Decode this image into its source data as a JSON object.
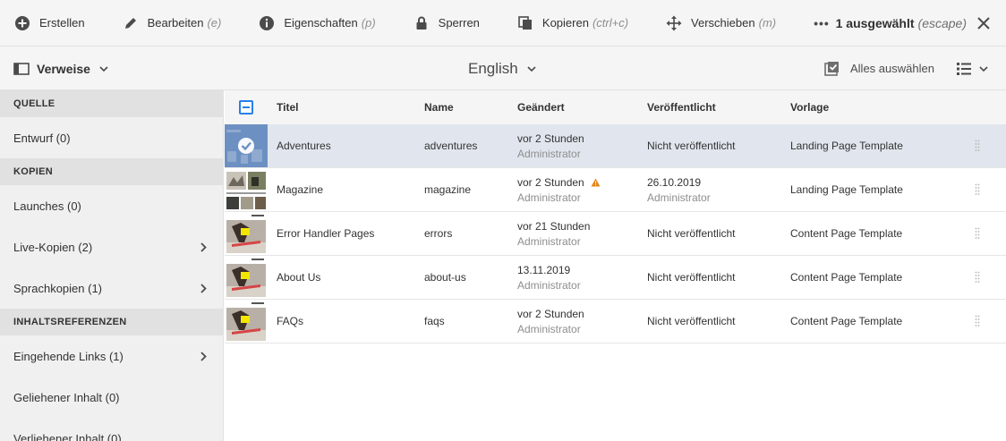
{
  "actionbar": {
    "create": "Erstellen",
    "edit": "Bearbeiten",
    "edit_key": "(e)",
    "properties": "Eigenschaften",
    "properties_key": "(p)",
    "lock": "Sperren",
    "copy": "Kopieren",
    "copy_key": "(ctrl+c)",
    "move": "Verschieben",
    "move_key": "(m)",
    "more": "•••",
    "selection_count": "1 ausgewählt",
    "selection_escape": "(escape)"
  },
  "header": {
    "rail_label": "Verweise",
    "language": "English",
    "select_all": "Alles auswählen"
  },
  "rail": {
    "source_heading": "QUELLE",
    "draft": "Entwurf (0)",
    "copies_heading": "KOPIEN",
    "launches": "Launches (0)",
    "live_copies": "Live-Kopien (2)",
    "language_copies": "Sprachkopien (1)",
    "content_refs_heading": "INHALTSREFERENZEN",
    "incoming_links": "Eingehende Links (1)",
    "borrowed": "Geliehener Inhalt (0)",
    "lent": "Verliehener Inhalt (0)"
  },
  "table": {
    "headers": {
      "title": "Titel",
      "name": "Name",
      "modified": "Geändert",
      "published": "Veröffentlicht",
      "template": "Vorlage"
    },
    "rows": [
      {
        "title": "Adventures",
        "name": "adventures",
        "modified": "vor 2 Stunden",
        "modified_by": "Administrator",
        "published": "Nicht veröffentlicht",
        "published_by": "",
        "template": "Landing Page Template"
      },
      {
        "title": "Magazine",
        "name": "magazine",
        "modified": "vor 2 Stunden",
        "modified_by": "Administrator",
        "published": "26.10.2019",
        "published_by": "Administrator",
        "template": "Landing Page Template"
      },
      {
        "title": "Error Handler Pages",
        "name": "errors",
        "modified": "vor 21 Stunden",
        "modified_by": "Administrator",
        "published": "Nicht veröffentlicht",
        "published_by": "",
        "template": "Content Page Template"
      },
      {
        "title": "About Us",
        "name": "about-us",
        "modified": "13.11.2019",
        "modified_by": "Administrator",
        "published": "Nicht veröffentlicht",
        "published_by": "",
        "template": "Content Page Template"
      },
      {
        "title": "FAQs",
        "name": "faqs",
        "modified": "vor 2 Stunden",
        "modified_by": "Administrator",
        "published": "Nicht veröffentlicht",
        "published_by": "",
        "template": "Content Page Template"
      }
    ]
  },
  "colors": {
    "accent": "#2680eb",
    "selected_row": "#e1e6ee",
    "warning": "#e68619"
  }
}
